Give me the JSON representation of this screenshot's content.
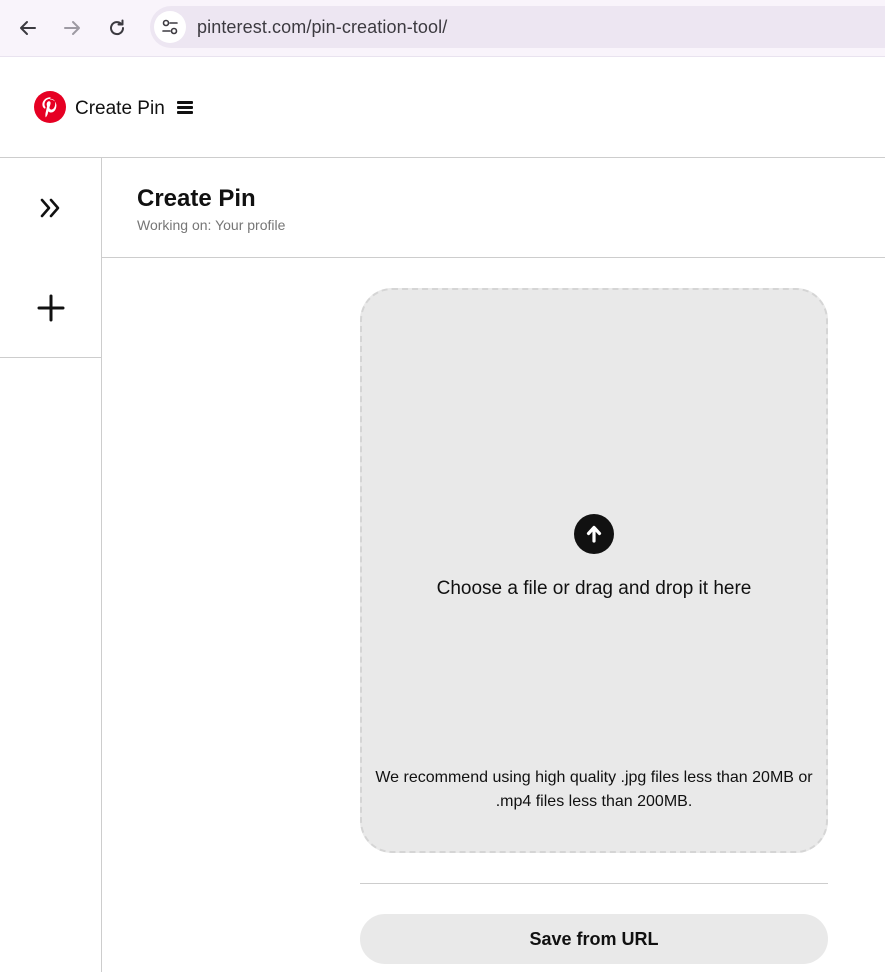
{
  "browser": {
    "url": "pinterest.com/pin-creation-tool/",
    "icons": {
      "back": "arrow-left-icon",
      "forward": "arrow-right-icon",
      "reload": "reload-icon",
      "site_info": "tune-icon"
    }
  },
  "header": {
    "logo": "pinterest-logo",
    "title": "Create Pin",
    "menu_icon": "hamburger-menu-icon",
    "brand_color": "#E60023"
  },
  "rail": {
    "items": [
      {
        "icon": "double-chevron-right-icon"
      },
      {
        "icon": "plus-icon"
      }
    ]
  },
  "main": {
    "title": "Create Pin",
    "subtitle": "Working on: Your profile",
    "dropzone": {
      "icon": "upload-arrow-icon",
      "primary_text": "Choose a file or drag and drop it here",
      "recommendation": "We recommend using high quality .jpg files less than 20MB or .mp4 files less than 200MB."
    },
    "save_from_url_label": "Save from URL"
  }
}
